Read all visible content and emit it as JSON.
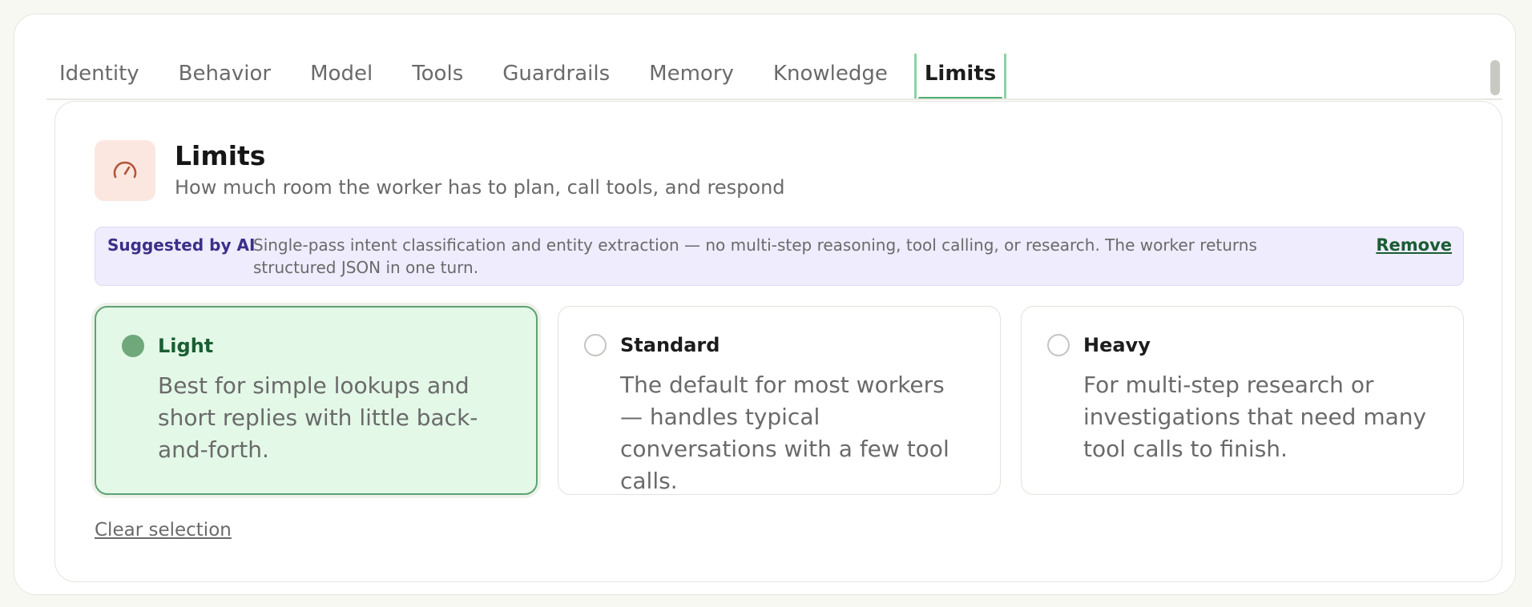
{
  "tabs": [
    {
      "label": "Identity"
    },
    {
      "label": "Behavior"
    },
    {
      "label": "Model"
    },
    {
      "label": "Tools"
    },
    {
      "label": "Guardrails"
    },
    {
      "label": "Memory"
    },
    {
      "label": "Knowledge"
    },
    {
      "label": "Limits",
      "active": true
    }
  ],
  "section": {
    "icon": "speedometer-icon",
    "title": "Limits",
    "subtitle": "How much room the worker has to plan, call tools, and respond"
  },
  "ai_suggestion": {
    "tag": "Suggested by AI",
    "text": "Single-pass intent classification and entity extraction — no multi-step reasoning, tool calling, or research. The worker returns structured JSON in one turn.",
    "remove_label": "Remove"
  },
  "options": [
    {
      "title": "Light",
      "description": "Best for simple lookups and short replies with little back-and-forth.",
      "selected": true
    },
    {
      "title": "Standard",
      "description": "The default for most workers — handles typical conversations with a few tool calls.",
      "selected": false
    },
    {
      "title": "Heavy",
      "description": "For multi-step research or investigations that need many tool calls to finish.",
      "selected": false
    }
  ],
  "clear_label": "Clear selection",
  "colors": {
    "accent_green": "#4fae70",
    "selected_bg": "#e3f8e7",
    "ai_banner_bg": "#eeecfd",
    "icon_bg": "#fbe7e0",
    "icon_stroke": "#b2553a"
  }
}
